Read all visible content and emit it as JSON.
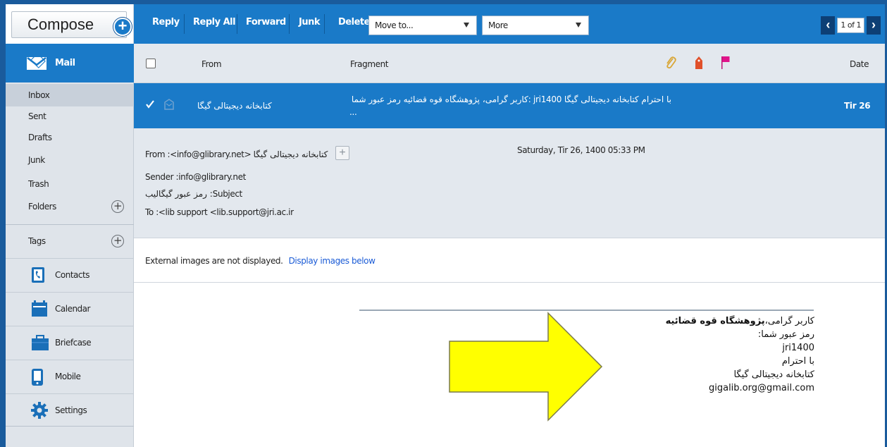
{
  "compose": {
    "label": "Compose"
  },
  "toolbar": {
    "reply": "Reply",
    "reply_all": "Reply All",
    "forward": "Forward",
    "junk": "Junk",
    "delete": "Delete",
    "move_to": "Move to...",
    "more": "More",
    "pager": "1 of 1"
  },
  "sidebar": {
    "mail": "Mail",
    "folders": [
      {
        "label": "Inbox"
      },
      {
        "label": "Sent"
      },
      {
        "label": "Drafts"
      },
      {
        "label": "Junk"
      },
      {
        "label": "Trash"
      }
    ],
    "folders_label": "Folders",
    "tags_label": "Tags",
    "apps": [
      {
        "label": "Contacts",
        "icon": "contacts-icon"
      },
      {
        "label": "Calendar",
        "icon": "calendar-icon"
      },
      {
        "label": "Briefcase",
        "icon": "briefcase-icon"
      },
      {
        "label": "Mobile",
        "icon": "mobile-icon"
      },
      {
        "label": "Settings",
        "icon": "settings-icon"
      }
    ]
  },
  "list": {
    "columns": {
      "from": "From",
      "fragment": "Fragment",
      "date": "Date"
    },
    "selected_message": {
      "from": "کتابخانه دیجیتالی گیگا",
      "fragment_line1": "با احترام کتابخانه دیجیتالی گیگا jri1400 :کاربر گرامی، پژوهشگاه قوه قضائیه رمز عبور شما",
      "fragment_line2": "...",
      "date": "Tir 26"
    }
  },
  "reading": {
    "from": "From :<info@glibrary.net> کتابخانه دیجیتالی گیگا",
    "sender": "Sender :info@glibrary.net",
    "subject": "رمز عبور گیگالیب :Subject",
    "to": "To :<lib support <lib.support@jri.ac.ir",
    "datetime": "Saturday, Tir 26, 1400 05:33 PM",
    "external_notice": "External images are not displayed.",
    "display_link": "Display images below"
  },
  "body": {
    "line1_prefix": "کاربر گرامی،",
    "line1_bold": "پژوهشگاه قوه قضائیه",
    "line2": "رمز عبور شما:",
    "line3": "jri1400",
    "line4": "با احترام",
    "line5": "کتابخانه دیجیتالی گیگا",
    "line6": "gigalib.org@gmail.com"
  },
  "colors": {
    "toolbar_blue": "#1a7ac8",
    "frame_blue": "#1a5b9c",
    "arrow_yellow": "#ffff00",
    "flag_pink": "#e0148a",
    "priority_red": "#e0502a"
  }
}
